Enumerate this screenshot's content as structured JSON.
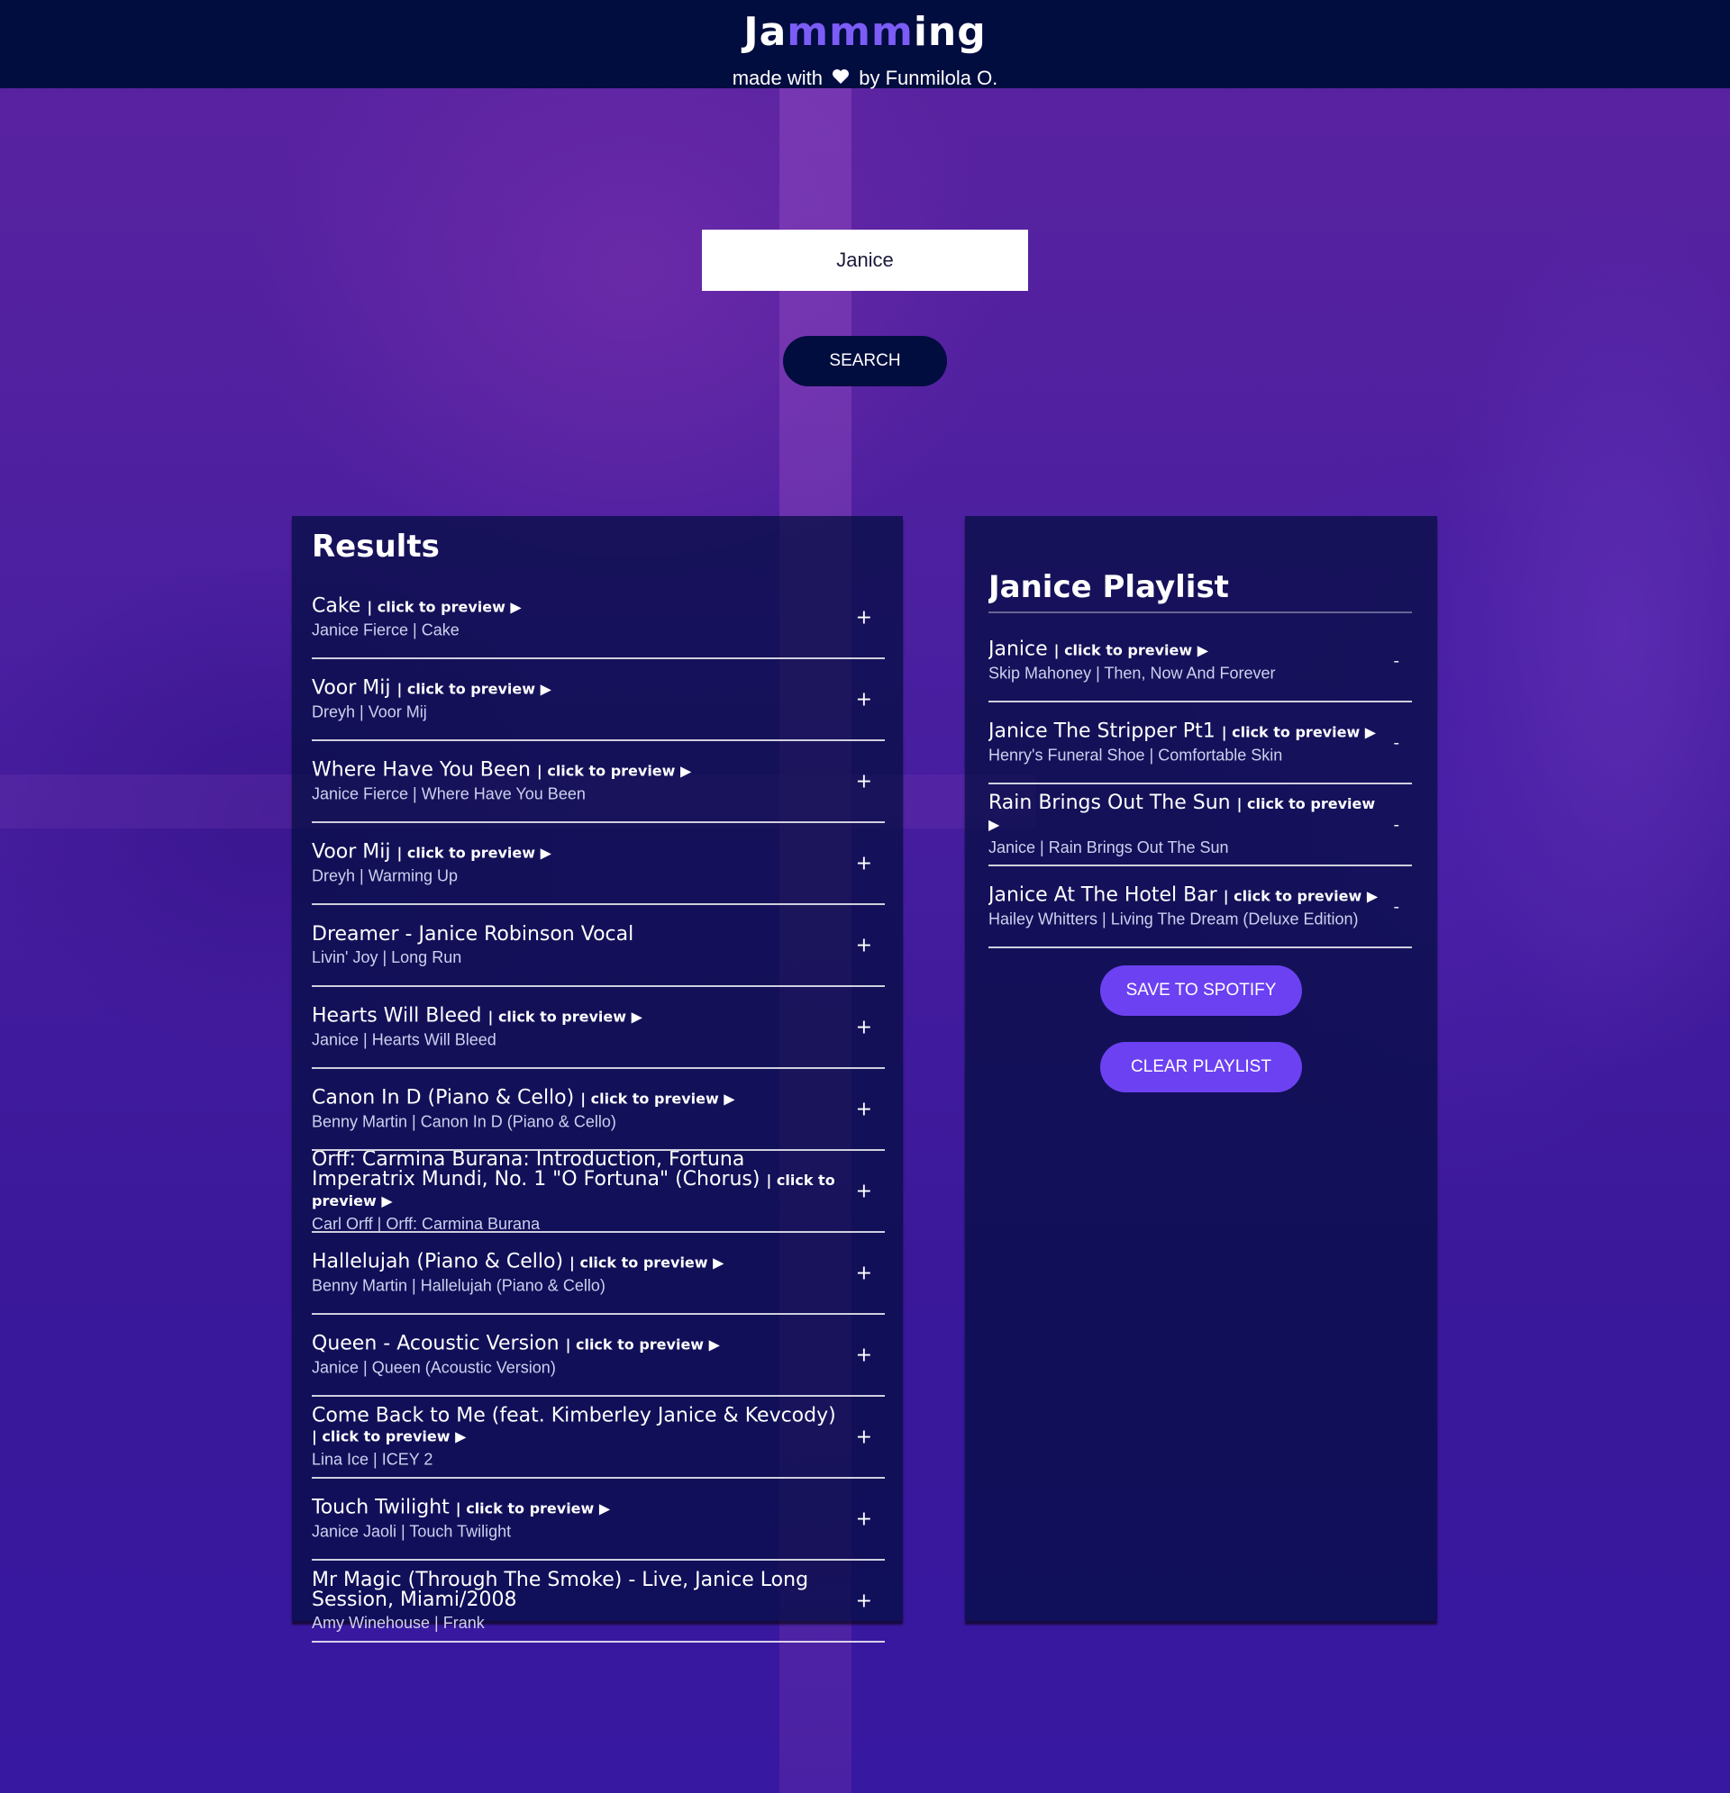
{
  "header": {
    "logo_pre": "Ja",
    "logo_accent": "mmm",
    "logo_post": "ing",
    "tagline_pre": "made with",
    "tagline_post": "by Funmilola O."
  },
  "search": {
    "value": "Janice",
    "button_label": "SEARCH"
  },
  "results": {
    "title": "Results",
    "tracks": [
      {
        "name": "Cake",
        "preview": "| click to preview ▶",
        "meta": "Janice Fierce | Cake",
        "action": "+"
      },
      {
        "name": "Voor Mij",
        "preview": "| click to preview ▶",
        "meta": "Dreyh | Voor Mij",
        "action": "+"
      },
      {
        "name": "Where Have You Been",
        "preview": "| click to preview ▶",
        "meta": "Janice Fierce | Where Have You Been",
        "action": "+"
      },
      {
        "name": "Voor Mij",
        "preview": "| click to preview ▶",
        "meta": "Dreyh | Warming Up",
        "action": "+"
      },
      {
        "name": "Dreamer - Janice Robinson Vocal",
        "preview": "",
        "meta": "Livin' Joy | Long Run",
        "action": "+"
      },
      {
        "name": "Hearts Will Bleed",
        "preview": "| click to preview ▶",
        "meta": "Janice | Hearts Will Bleed",
        "action": "+"
      },
      {
        "name": "Canon In D (Piano & Cello)",
        "preview": "| click to preview ▶",
        "meta": "Benny Martin | Canon In D (Piano & Cello)",
        "action": "+"
      },
      {
        "name": "Orff: Carmina Burana: Introduction, Fortuna Imperatrix Mundi, No. 1 \"O Fortuna\" (Chorus)",
        "preview": "| click to preview ▶",
        "meta": "Carl Orff | Orff: Carmina Burana",
        "action": "+"
      },
      {
        "name": "Hallelujah (Piano & Cello)",
        "preview": "| click to preview ▶",
        "meta": "Benny Martin | Hallelujah (Piano & Cello)",
        "action": "+"
      },
      {
        "name": "Queen - Acoustic Version",
        "preview": "| click to preview ▶",
        "meta": "Janice | Queen (Acoustic Version)",
        "action": "+"
      },
      {
        "name": "Come Back to Me (feat. Kimberley Janice & Kevcody)",
        "preview": "| click to preview ▶",
        "meta": "Lina Ice | ICEY 2",
        "action": "+"
      },
      {
        "name": "Touch Twilight",
        "preview": "| click to preview ▶",
        "meta": "Janice Jaoli | Touch Twilight",
        "action": "+"
      },
      {
        "name": "Mr Magic (Through The Smoke) - Live, Janice Long Session, Miami/2008",
        "preview": "",
        "meta": "Amy Winehouse | Frank",
        "action": "+"
      }
    ]
  },
  "playlist": {
    "name": "Janice Playlist",
    "tracks": [
      {
        "name": "Janice",
        "preview": "| click to preview ▶",
        "meta": "Skip Mahoney | Then, Now And Forever",
        "action": "-"
      },
      {
        "name": "Janice The Stripper Pt1",
        "preview": "| click to preview ▶",
        "meta": "Henry's Funeral Shoe | Comfortable Skin",
        "action": "-"
      },
      {
        "name": "Rain Brings Out The Sun",
        "preview": "| click to preview ▶",
        "meta": "Janice | Rain Brings Out The Sun",
        "action": "-"
      },
      {
        "name": "Janice At The Hotel Bar",
        "preview": "| click to preview ▶",
        "meta": "Hailey Whitters | Living The Dream (Deluxe Edition)",
        "action": "-"
      }
    ],
    "save_label": "SAVE TO SPOTIFY",
    "clear_label": "CLEAR PLAYLIST"
  },
  "colors": {
    "header_bg": "#010c3f",
    "accent": "#7c5cf6",
    "button_purple": "#6c41f2",
    "panel_bg": "#010c3f"
  },
  "icons": {
    "heart": "heart-icon",
    "preview": "play-icon"
  }
}
